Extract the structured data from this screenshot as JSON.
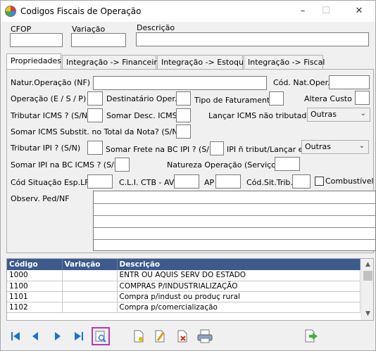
{
  "window": {
    "title": "Codigos Fiscais de Operação"
  },
  "header": {
    "cfop_label": "CFOP",
    "variacao_label": "Variação",
    "descricao_label": "Descrição"
  },
  "tabs": [
    {
      "label": "Propriedades"
    },
    {
      "label": "Integração -> Financeiro"
    },
    {
      "label": "Integração -> Estoque"
    },
    {
      "label": "Integração -> Fiscal"
    }
  ],
  "form": {
    "natur_operacao": "Natur.Operação (NF)",
    "cod_nat_oper": "Cód. Nat.Oper.",
    "operacao": "Operação (E / S / P)",
    "destinatario": "Destinatário Oper.",
    "tipo_faturamento": "Tipo de Faturamento",
    "altera_custo": "Altera Custo",
    "tributar_icms": "Tributar ICMS ? (S/N)",
    "somar_desc_icms": "Somar Desc. ICMS?",
    "lancar_icms": "Lançar ICMS não tributado",
    "lancar_icms_value": "Outras",
    "somar_icms_subst": "Somar ICMS Substit. no Total da Nota? (S/N)",
    "tributar_ipi": "Tributar IPI ? (S/N)",
    "somar_frete": "Somar Frete na BC IPI ? (S/N)",
    "ipi_nao_tribut": "IPI ñ tribut/Lançar em",
    "ipi_value": "Outras",
    "somar_ipi_bc": "Somar IPI na BC ICMS ? (S/N)",
    "natureza_servicos": "Natureza Operação (Serviços)",
    "cod_situacao": "Cód Situação Esp.LFS",
    "cli_ctb": "C.L.I. CTB - AV",
    "ap": "AP",
    "cod_sit_trib": "Cód.Sit.Trib.",
    "combustivel": "Combustível",
    "observ": "Observ. Ped/NF"
  },
  "grid": {
    "columns": [
      "Código",
      "Variação",
      "Descrição"
    ],
    "rows": [
      {
        "codigo": "1000",
        "variacao": "",
        "descricao": "ENTR OU AQUIS SERV DO ESTADO"
      },
      {
        "codigo": "1100",
        "variacao": "",
        "descricao": "COMPRAS P/INDUSTRIALIZAÇÃO"
      },
      {
        "codigo": "1101",
        "variacao": "",
        "descricao": "Compra p/indust ou produç rural"
      },
      {
        "codigo": "1102",
        "variacao": "",
        "descricao": "Compra p/comercialização"
      }
    ]
  },
  "icons": {
    "nav_first": "first-record-icon",
    "nav_prev": "prev-record-icon",
    "nav_next": "next-record-icon",
    "nav_last": "last-record-icon",
    "search": "search-icon",
    "new": "new-record-icon",
    "edit": "edit-icon",
    "delete": "delete-icon",
    "print": "print-icon",
    "exit": "exit-icon"
  }
}
